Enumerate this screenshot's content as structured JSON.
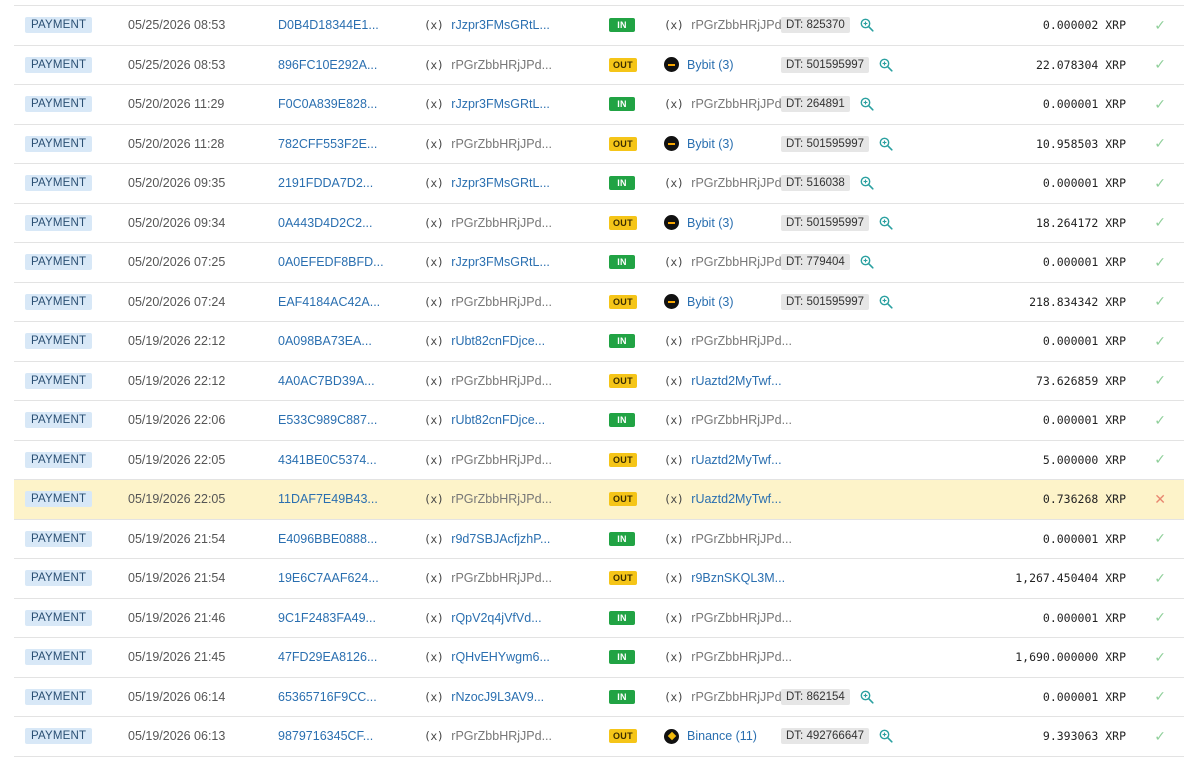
{
  "colors": {
    "link": "#2a6fb0",
    "in_badge": "#21a344",
    "out_badge": "#f5c518",
    "failed_row": "#fdf3c9",
    "success_check": "#8fcf9a",
    "fail_cross": "#e8866f"
  },
  "icons": {
    "unknown_address": "(x)",
    "success": "✓",
    "failure": "✕"
  },
  "rows": [
    {
      "type": "PAYMENT",
      "date": "05/25/2026 08:53",
      "hash": "D0B4D18344E1...",
      "from": "rJzpr3FMsGRtL...",
      "from_link": true,
      "dir": "IN",
      "to": "rPGrZbbHRjJPd...",
      "to_link": false,
      "to_logo": "",
      "tag": "DT: 825370",
      "amount": "0.000002 XRP",
      "status": "ok"
    },
    {
      "type": "PAYMENT",
      "date": "05/25/2026 08:53",
      "hash": "896FC10E292A...",
      "from": "rPGrZbbHRjJPd...",
      "from_link": false,
      "dir": "OUT",
      "to": "Bybit (3)",
      "to_link": true,
      "to_logo": "bybit",
      "tag": "DT: 501595997",
      "amount": "22.078304 XRP",
      "status": "ok"
    },
    {
      "type": "PAYMENT",
      "date": "05/20/2026 11:29",
      "hash": "F0C0A839E828...",
      "from": "rJzpr3FMsGRtL...",
      "from_link": true,
      "dir": "IN",
      "to": "rPGrZbbHRjJPd...",
      "to_link": false,
      "to_logo": "",
      "tag": "DT: 264891",
      "amount": "0.000001 XRP",
      "status": "ok"
    },
    {
      "type": "PAYMENT",
      "date": "05/20/2026 11:28",
      "hash": "782CFF553F2E...",
      "from": "rPGrZbbHRjJPd...",
      "from_link": false,
      "dir": "OUT",
      "to": "Bybit (3)",
      "to_link": true,
      "to_logo": "bybit",
      "tag": "DT: 501595997",
      "amount": "10.958503 XRP",
      "status": "ok"
    },
    {
      "type": "PAYMENT",
      "date": "05/20/2026 09:35",
      "hash": "2191FDDA7D2...",
      "from": "rJzpr3FMsGRtL...",
      "from_link": true,
      "dir": "IN",
      "to": "rPGrZbbHRjJPd...",
      "to_link": false,
      "to_logo": "",
      "tag": "DT: 516038",
      "amount": "0.000001 XRP",
      "status": "ok"
    },
    {
      "type": "PAYMENT",
      "date": "05/20/2026 09:34",
      "hash": "0A443D4D2C2...",
      "from": "rPGrZbbHRjJPd...",
      "from_link": false,
      "dir": "OUT",
      "to": "Bybit (3)",
      "to_link": true,
      "to_logo": "bybit",
      "tag": "DT: 501595997",
      "amount": "18.264172 XRP",
      "status": "ok"
    },
    {
      "type": "PAYMENT",
      "date": "05/20/2026 07:25",
      "hash": "0A0EFEDF8BFD...",
      "from": "rJzpr3FMsGRtL...",
      "from_link": true,
      "dir": "IN",
      "to": "rPGrZbbHRjJPd...",
      "to_link": false,
      "to_logo": "",
      "tag": "DT: 779404",
      "amount": "0.000001 XRP",
      "status": "ok"
    },
    {
      "type": "PAYMENT",
      "date": "05/20/2026 07:24",
      "hash": "EAF4184AC42A...",
      "from": "rPGrZbbHRjJPd...",
      "from_link": false,
      "dir": "OUT",
      "to": "Bybit (3)",
      "to_link": true,
      "to_logo": "bybit",
      "tag": "DT: 501595997",
      "amount": "218.834342 XRP",
      "status": "ok"
    },
    {
      "type": "PAYMENT",
      "date": "05/19/2026 22:12",
      "hash": "0A098BA73EA...",
      "from": "rUbt82cnFDjce...",
      "from_link": true,
      "dir": "IN",
      "to": "rPGrZbbHRjJPd...",
      "to_link": false,
      "to_logo": "",
      "tag": "",
      "amount": "0.000001 XRP",
      "status": "ok"
    },
    {
      "type": "PAYMENT",
      "date": "05/19/2026 22:12",
      "hash": "4A0AC7BD39A...",
      "from": "rPGrZbbHRjJPd...",
      "from_link": false,
      "dir": "OUT",
      "to": "rUaztd2MyTwf...",
      "to_link": true,
      "to_logo": "",
      "tag": "",
      "amount": "73.626859 XRP",
      "status": "ok"
    },
    {
      "type": "PAYMENT",
      "date": "05/19/2026 22:06",
      "hash": "E533C989C887...",
      "from": "rUbt82cnFDjce...",
      "from_link": true,
      "dir": "IN",
      "to": "rPGrZbbHRjJPd...",
      "to_link": false,
      "to_logo": "",
      "tag": "",
      "amount": "0.000001 XRP",
      "status": "ok"
    },
    {
      "type": "PAYMENT",
      "date": "05/19/2026 22:05",
      "hash": "4341BE0C5374...",
      "from": "rPGrZbbHRjJPd...",
      "from_link": false,
      "dir": "OUT",
      "to": "rUaztd2MyTwf...",
      "to_link": true,
      "to_logo": "",
      "tag": "",
      "amount": "5.000000 XRP",
      "status": "ok"
    },
    {
      "type": "PAYMENT",
      "date": "05/19/2026 22:05",
      "hash": "11DAF7E49B43...",
      "from": "rPGrZbbHRjJPd...",
      "from_link": false,
      "dir": "OUT",
      "to": "rUaztd2MyTwf...",
      "to_link": true,
      "to_logo": "",
      "tag": "",
      "amount": "0.736268 XRP",
      "status": "fail"
    },
    {
      "type": "PAYMENT",
      "date": "05/19/2026 21:54",
      "hash": "E4096BBE0888...",
      "from": "r9d7SBJAcfjzhP...",
      "from_link": true,
      "dir": "IN",
      "to": "rPGrZbbHRjJPd...",
      "to_link": false,
      "to_logo": "",
      "tag": "",
      "amount": "0.000001 XRP",
      "status": "ok"
    },
    {
      "type": "PAYMENT",
      "date": "05/19/2026 21:54",
      "hash": "19E6C7AAF624...",
      "from": "rPGrZbbHRjJPd...",
      "from_link": false,
      "dir": "OUT",
      "to": "r9BznSKQL3M...",
      "to_link": true,
      "to_logo": "",
      "tag": "",
      "amount": "1,267.450404 XRP",
      "status": "ok"
    },
    {
      "type": "PAYMENT",
      "date": "05/19/2026 21:46",
      "hash": "9C1F2483FA49...",
      "from": "rQpV2q4jVfVd...",
      "from_link": true,
      "dir": "IN",
      "to": "rPGrZbbHRjJPd...",
      "to_link": false,
      "to_logo": "",
      "tag": "",
      "amount": "0.000001 XRP",
      "status": "ok"
    },
    {
      "type": "PAYMENT",
      "date": "05/19/2026 21:45",
      "hash": "47FD29EA8126...",
      "from": "rQHvEHYwgm6...",
      "from_link": true,
      "dir": "IN",
      "to": "rPGrZbbHRjJPd...",
      "to_link": false,
      "to_logo": "",
      "tag": "",
      "amount": "1,690.000000 XRP",
      "status": "ok"
    },
    {
      "type": "PAYMENT",
      "date": "05/19/2026 06:14",
      "hash": "65365716F9CC...",
      "from": "rNzocJ9L3AV9...",
      "from_link": true,
      "dir": "IN",
      "to": "rPGrZbbHRjJPd...",
      "to_link": false,
      "to_logo": "",
      "tag": "DT: 862154",
      "amount": "0.000001 XRP",
      "status": "ok"
    },
    {
      "type": "PAYMENT",
      "date": "05/19/2026 06:13",
      "hash": "9879716345CF...",
      "from": "rPGrZbbHRjJPd...",
      "from_link": false,
      "dir": "OUT",
      "to": "Binance (11)",
      "to_link": true,
      "to_logo": "binance",
      "tag": "DT: 492766647",
      "amount": "9.393063 XRP",
      "status": "ok"
    }
  ]
}
